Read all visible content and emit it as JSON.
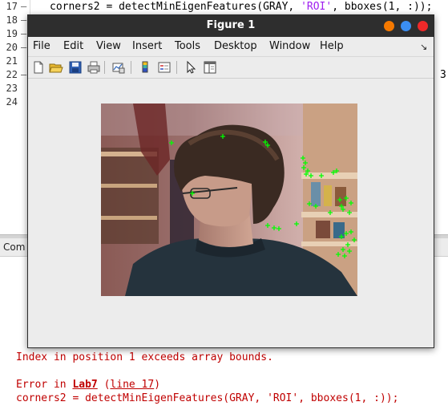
{
  "editor": {
    "line_numbers": [
      "17",
      "18",
      "19",
      "20",
      "21",
      "22",
      "23",
      "24"
    ],
    "line17_code": "corners2 = detectMinEigenFeatures(GRAY, 'ROI', bboxes(1, :));",
    "line22_tail": "3"
  },
  "command_window": {
    "title": "Com",
    "error_message": "Index in position 1 exceeds array bounds.",
    "error_in_prefix": "Error in ",
    "error_in_function": "Lab7",
    "error_in_line": "line 17",
    "error_code": "corners2 = detectMinEigenFeatures(GRAY, 'ROI', bboxes(1, :));"
  },
  "figure": {
    "title": "Figure 1",
    "menu": [
      "File",
      "Edit",
      "View",
      "Insert",
      "Tools",
      "Desktop",
      "Window",
      "Help"
    ],
    "dock_arrow": "↘",
    "toolbar_icons": [
      "new-figure-icon",
      "open-file-icon",
      "save-icon",
      "print-icon",
      "link-plot-icon",
      "insert-colorbar-icon",
      "insert-legend-icon",
      "edit-plot-arrow-icon",
      "property-inspector-icon"
    ],
    "marker_color": "#00ff00",
    "background_color": "#ececec"
  }
}
